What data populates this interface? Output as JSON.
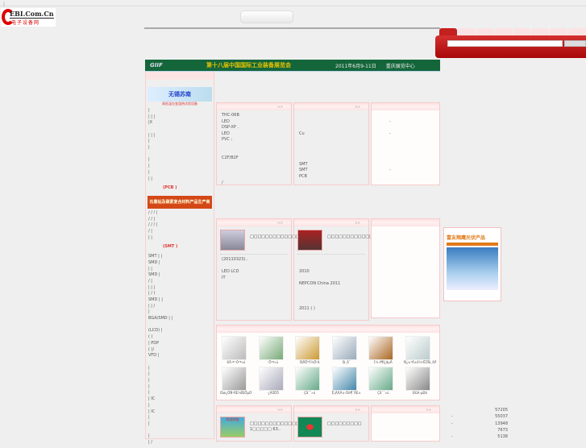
{
  "header": {
    "logo_main": "EBI.Com.Cn",
    "logo_sub": "电子设备网"
  },
  "banner": {
    "logo": "GIIF",
    "title": "第十八届中国国际工业装备展览会",
    "date": "2011年6月9-11日",
    "place": "重庆展览中心"
  },
  "sidebar": {
    "ad1": "无锡苏南",
    "ad1_sub": "高低温交变湿热试验设备",
    "ad2": "石墨钻及碳素复合材料产品生产商",
    "lines1": [
      "|",
      "|  |  |",
      "|X",
      "",
      "|  |  |",
      "|",
      "|",
      "",
      "|",
      "|",
      "|",
      "|  |"
    ],
    "red1": "(PCB  )",
    "lines2": [
      "/ / /  |",
      "/  /  |",
      "/ / /  |",
      "/  |",
      "|  |"
    ],
    "red2": "(SMT  )",
    "lines3": [
      "SMT  |  |",
      "SMD  |",
      "|  |",
      "SMD  |",
      "/  |",
      "|  |  |",
      "|  /  )",
      "SMD  |  |",
      "|  | /",
      "|",
      "BGA/SMD  |  |",
      "",
      "(LCD)  |",
      "(  )",
      "| PDP",
      "( )/",
      "VFD  |",
      "",
      "|",
      "|",
      "|",
      "|",
      "|",
      "| IC",
      "|",
      "| IC",
      "|",
      "|",
      "",
      "|",
      "|  /"
    ]
  },
  "panels_row1": [
    {
      "more": ">>",
      "lines": [
        "THC-06B",
        "LED",
        "DSP-XP .",
        "LED",
        "PVC ;",
        "",
        "",
        "C2F/B2F",
        "",
        "",
        "",
        "/"
      ]
    },
    {
      "more": ">>",
      "lines": [
        "",
        "",
        "",
        "Cu",
        "",
        "",
        "",
        "",
        "SMT",
        "SMT",
        "PCB"
      ]
    },
    {
      "more": "",
      "lines": [
        "",
        "-",
        "",
        "-",
        "",
        "",
        "",
        "",
        "",
        "-"
      ]
    }
  ],
  "panels_row2": [
    {
      "more": ">>",
      "title": "□□□□□□□□□□□□□□□□□□",
      "lines": [
        "(20110323)..",
        "",
        "LED LCD",
        "IT",
        "",
        "",
        "",
        "",
        ""
      ]
    },
    {
      "more": ">>",
      "title": "□□□□□□□□□□□□□□□□-",
      "lines": [
        "",
        "",
        "2010",
        "",
        "NEPCON China 2011",
        "",
        "",
        "",
        "2011 (  )"
      ]
    },
    {
      "more": ""
    }
  ],
  "products": {
    "more": "",
    "items": [
      {
        "caption": "ßÃ·ª³·Ó³ª»ú"
      },
      {
        "caption": "·Ö³ª»ú"
      },
      {
        "caption": "ÌåÄÖ³Ý¼Ö²ã"
      },
      {
        "caption": "Ìâ¸ß¨"
      },
      {
        "caption": "Ì½·ñ¶Í¿ãµÄ"
      },
      {
        "caption": "Ñ¿±³Ã±ê¼²ÊÔÏä¸ßÂÁ"
      },
      {
        "caption": "Õæ¿ÕÑ¹ÃÈ¼ÏÐÖµÔ°"
      },
      {
        "caption": "·¿ÀÜÊÕ"
      },
      {
        "caption": "Çå´¨»ú"
      },
      {
        "caption": "Ê¡ÃÂÃ±·Õè¶¨ÅÈ±"
      },
      {
        "caption": "Çå´¨»ú"
      },
      {
        "caption": "BGA·µÐÞ"
      }
    ]
  },
  "panels_row4": [
    {
      "more": ">>",
      "title": "□□□□□□□□□□□□□□□□",
      "sub": "1□□□□□ 63..",
      "ad": "欢迎光临"
    },
    {
      "more": ">>",
      "title": "□□□□□□□□□"
    },
    {
      "more": ">>"
    }
  ],
  "right": {
    "cover_title": "富友翔鹰光伏产品",
    "stats": [
      {
        "label": "",
        "value": "57205"
      },
      {
        "label": "-",
        "value": "55037"
      },
      {
        "label": "-",
        "value": "13948"
      },
      {
        "label": "",
        "value": "7673"
      },
      {
        "label": "-",
        "value": "5138"
      }
    ]
  }
}
